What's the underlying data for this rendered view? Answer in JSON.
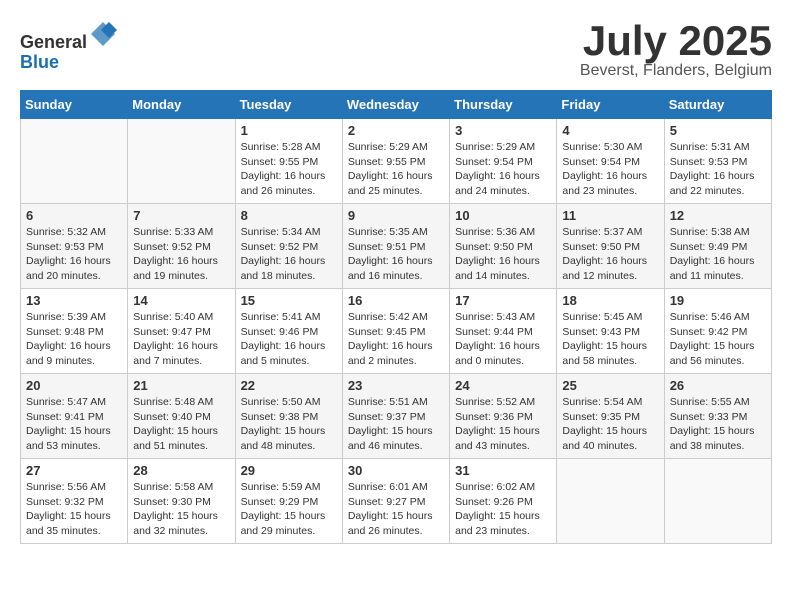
{
  "header": {
    "logo_line1": "General",
    "logo_line2": "Blue",
    "month": "July 2025",
    "location": "Beverst, Flanders, Belgium"
  },
  "weekdays": [
    "Sunday",
    "Monday",
    "Tuesday",
    "Wednesday",
    "Thursday",
    "Friday",
    "Saturday"
  ],
  "weeks": [
    [
      {
        "day": "",
        "data": ""
      },
      {
        "day": "",
        "data": ""
      },
      {
        "day": "1",
        "data": "Sunrise: 5:28 AM\nSunset: 9:55 PM\nDaylight: 16 hours and 26 minutes."
      },
      {
        "day": "2",
        "data": "Sunrise: 5:29 AM\nSunset: 9:55 PM\nDaylight: 16 hours and 25 minutes."
      },
      {
        "day": "3",
        "data": "Sunrise: 5:29 AM\nSunset: 9:54 PM\nDaylight: 16 hours and 24 minutes."
      },
      {
        "day": "4",
        "data": "Sunrise: 5:30 AM\nSunset: 9:54 PM\nDaylight: 16 hours and 23 minutes."
      },
      {
        "day": "5",
        "data": "Sunrise: 5:31 AM\nSunset: 9:53 PM\nDaylight: 16 hours and 22 minutes."
      }
    ],
    [
      {
        "day": "6",
        "data": "Sunrise: 5:32 AM\nSunset: 9:53 PM\nDaylight: 16 hours and 20 minutes."
      },
      {
        "day": "7",
        "data": "Sunrise: 5:33 AM\nSunset: 9:52 PM\nDaylight: 16 hours and 19 minutes."
      },
      {
        "day": "8",
        "data": "Sunrise: 5:34 AM\nSunset: 9:52 PM\nDaylight: 16 hours and 18 minutes."
      },
      {
        "day": "9",
        "data": "Sunrise: 5:35 AM\nSunset: 9:51 PM\nDaylight: 16 hours and 16 minutes."
      },
      {
        "day": "10",
        "data": "Sunrise: 5:36 AM\nSunset: 9:50 PM\nDaylight: 16 hours and 14 minutes."
      },
      {
        "day": "11",
        "data": "Sunrise: 5:37 AM\nSunset: 9:50 PM\nDaylight: 16 hours and 12 minutes."
      },
      {
        "day": "12",
        "data": "Sunrise: 5:38 AM\nSunset: 9:49 PM\nDaylight: 16 hours and 11 minutes."
      }
    ],
    [
      {
        "day": "13",
        "data": "Sunrise: 5:39 AM\nSunset: 9:48 PM\nDaylight: 16 hours and 9 minutes."
      },
      {
        "day": "14",
        "data": "Sunrise: 5:40 AM\nSunset: 9:47 PM\nDaylight: 16 hours and 7 minutes."
      },
      {
        "day": "15",
        "data": "Sunrise: 5:41 AM\nSunset: 9:46 PM\nDaylight: 16 hours and 5 minutes."
      },
      {
        "day": "16",
        "data": "Sunrise: 5:42 AM\nSunset: 9:45 PM\nDaylight: 16 hours and 2 minutes."
      },
      {
        "day": "17",
        "data": "Sunrise: 5:43 AM\nSunset: 9:44 PM\nDaylight: 16 hours and 0 minutes."
      },
      {
        "day": "18",
        "data": "Sunrise: 5:45 AM\nSunset: 9:43 PM\nDaylight: 15 hours and 58 minutes."
      },
      {
        "day": "19",
        "data": "Sunrise: 5:46 AM\nSunset: 9:42 PM\nDaylight: 15 hours and 56 minutes."
      }
    ],
    [
      {
        "day": "20",
        "data": "Sunrise: 5:47 AM\nSunset: 9:41 PM\nDaylight: 15 hours and 53 minutes."
      },
      {
        "day": "21",
        "data": "Sunrise: 5:48 AM\nSunset: 9:40 PM\nDaylight: 15 hours and 51 minutes."
      },
      {
        "day": "22",
        "data": "Sunrise: 5:50 AM\nSunset: 9:38 PM\nDaylight: 15 hours and 48 minutes."
      },
      {
        "day": "23",
        "data": "Sunrise: 5:51 AM\nSunset: 9:37 PM\nDaylight: 15 hours and 46 minutes."
      },
      {
        "day": "24",
        "data": "Sunrise: 5:52 AM\nSunset: 9:36 PM\nDaylight: 15 hours and 43 minutes."
      },
      {
        "day": "25",
        "data": "Sunrise: 5:54 AM\nSunset: 9:35 PM\nDaylight: 15 hours and 40 minutes."
      },
      {
        "day": "26",
        "data": "Sunrise: 5:55 AM\nSunset: 9:33 PM\nDaylight: 15 hours and 38 minutes."
      }
    ],
    [
      {
        "day": "27",
        "data": "Sunrise: 5:56 AM\nSunset: 9:32 PM\nDaylight: 15 hours and 35 minutes."
      },
      {
        "day": "28",
        "data": "Sunrise: 5:58 AM\nSunset: 9:30 PM\nDaylight: 15 hours and 32 minutes."
      },
      {
        "day": "29",
        "data": "Sunrise: 5:59 AM\nSunset: 9:29 PM\nDaylight: 15 hours and 29 minutes."
      },
      {
        "day": "30",
        "data": "Sunrise: 6:01 AM\nSunset: 9:27 PM\nDaylight: 15 hours and 26 minutes."
      },
      {
        "day": "31",
        "data": "Sunrise: 6:02 AM\nSunset: 9:26 PM\nDaylight: 15 hours and 23 minutes."
      },
      {
        "day": "",
        "data": ""
      },
      {
        "day": "",
        "data": ""
      }
    ]
  ]
}
